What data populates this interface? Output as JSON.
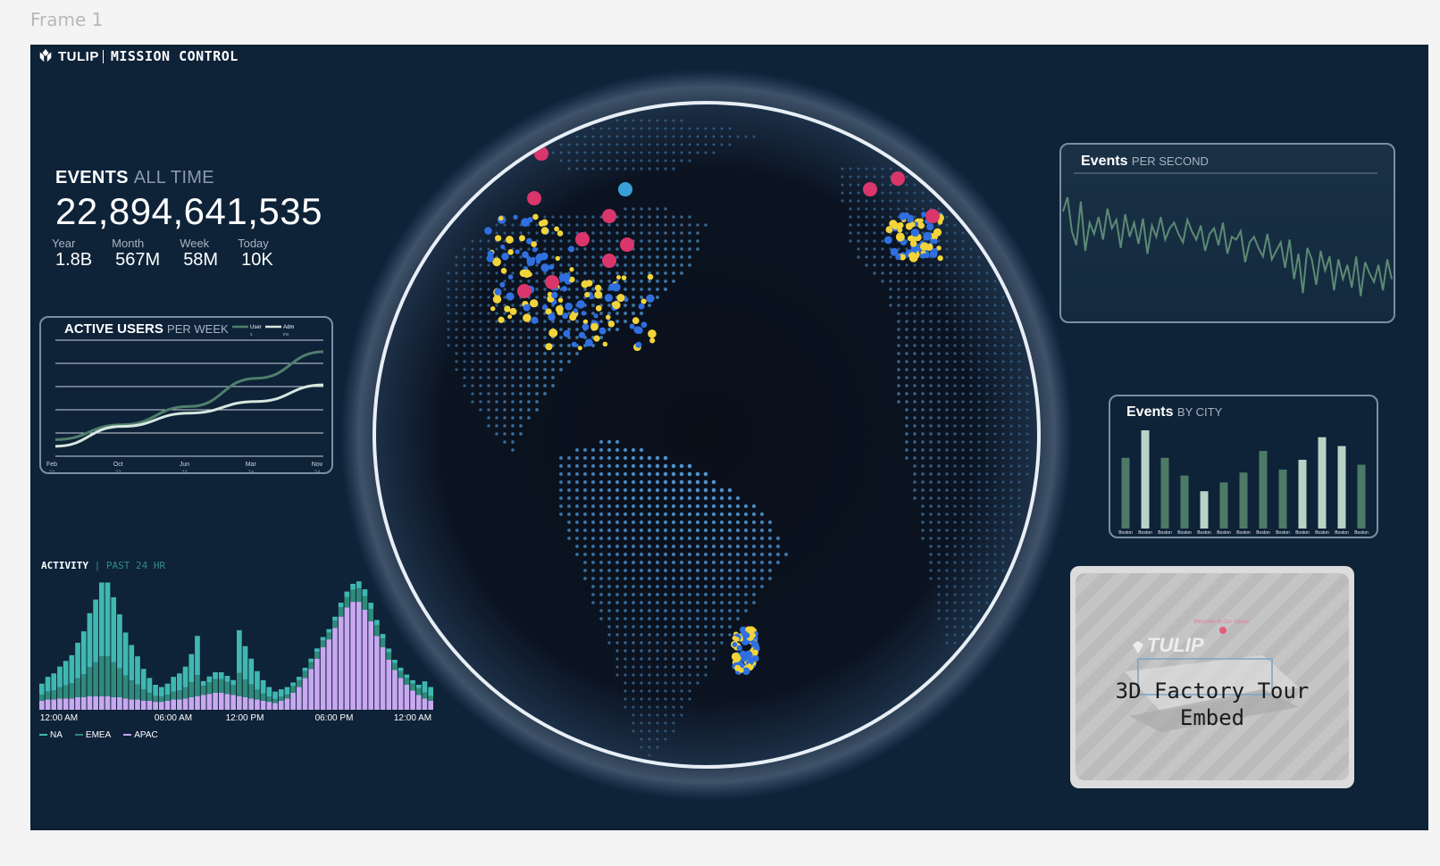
{
  "frame": {
    "label": "Frame 1"
  },
  "header": {
    "logo_text": "TULIP",
    "title": "MISSION CONTROL"
  },
  "events_all_time": {
    "title": "EVENTS",
    "subtitle": "ALL TIME",
    "total": "22,894,641,535",
    "stats": [
      {
        "label": "Year",
        "value": "1.8B"
      },
      {
        "label": "Month",
        "value": "567M"
      },
      {
        "label": "Week",
        "value": "58M"
      },
      {
        "label": "Today",
        "value": "10K"
      }
    ]
  },
  "active_users": {
    "title": "ACTIVE USERS",
    "subtitle": "PER WEEK",
    "legend": [
      {
        "name": "User",
        "sub": "s",
        "color": "#4f7f6c"
      },
      {
        "name": "Adm",
        "sub": "ins",
        "color": "#d6e7df"
      }
    ],
    "x_ticks": [
      {
        "month": "Feb",
        "year": "22"
      },
      {
        "month": "Oct",
        "year": "22"
      },
      {
        "month": "Jun",
        "year": "23"
      },
      {
        "month": "Mar",
        "year": "24"
      },
      {
        "month": "Nov",
        "year": "24"
      }
    ]
  },
  "events_per_second": {
    "title": "Events",
    "subtitle": "PER SECOND",
    "line_color": "#5c8a74"
  },
  "events_by_city": {
    "title": "Events",
    "subtitle": "BY CITY",
    "bar_dark": "#4d7a66",
    "bar_light": "#b9d2c6"
  },
  "activity": {
    "title": "ACTIVITY",
    "subtitle": "PAST 24 HR",
    "x_ticks": [
      "12:00 AM",
      "06:00 AM",
      "12:00 PM",
      "06:00 PM",
      "12:00 AM"
    ],
    "legend": [
      {
        "name": "NA",
        "color": "#3fb8b0"
      },
      {
        "name": "EMEA",
        "color": "#2f8a7a"
      },
      {
        "name": "APAC",
        "color": "#c8a8f0"
      }
    ]
  },
  "embed": {
    "line1": "3D Factory Tour",
    "line2": "Embed",
    "logo_text": "TULIP",
    "tiny_caption": "Welcome to Our Space"
  },
  "chart_data": [
    {
      "type": "line",
      "title": "ACTIVE USERS PER WEEK",
      "categories": [
        "Feb 22",
        "Oct 22",
        "Jun 23",
        "Mar 24",
        "Nov 24"
      ],
      "series": [
        {
          "name": "Users",
          "values": [
            1.0,
            1.9,
            3.0,
            4.7,
            6.3
          ]
        },
        {
          "name": "Admins",
          "values": [
            0.6,
            1.8,
            2.6,
            3.3,
            4.3
          ]
        }
      ],
      "ylim": [
        0,
        7
      ],
      "grid": true
    },
    {
      "type": "line",
      "title": "Events PER SECOND",
      "values": [
        78,
        88,
        64,
        54,
        85,
        50,
        70,
        62,
        74,
        58,
        80,
        66,
        72,
        52,
        76,
        60,
        70,
        55,
        73,
        48,
        68,
        60,
        74,
        58,
        66,
        70,
        62,
        56,
        72,
        64,
        58,
        68,
        50,
        62,
        66,
        54,
        70,
        48,
        60,
        58,
        64,
        42,
        56,
        60,
        52,
        46,
        62,
        44,
        50,
        56,
        38,
        58,
        30,
        48,
        20,
        52,
        44,
        26,
        50,
        36,
        46,
        22,
        44,
        30,
        40,
        24,
        46,
        18,
        42,
        34,
        28,
        40,
        22,
        44,
        30
      ]
    },
    {
      "type": "bar",
      "title": "Events BY CITY",
      "categories": [
        "Boston",
        "Boston",
        "Boston",
        "Boston",
        "Boston",
        "Boston",
        "Boston",
        "Boston",
        "Boston",
        "Boston",
        "Boston",
        "Boston",
        "Boston"
      ],
      "values": [
        72,
        100,
        72,
        54,
        38,
        47,
        57,
        79,
        60,
        70,
        93,
        84,
        65
      ],
      "highlight": [
        false,
        true,
        false,
        false,
        true,
        false,
        false,
        false,
        false,
        true,
        true,
        true,
        false
      ]
    },
    {
      "type": "bar",
      "title": "ACTIVITY PAST 24 HR",
      "stacked": true,
      "categories": [
        "12:00 AM",
        "06:00 AM",
        "12:00 PM",
        "06:00 PM",
        "12:00 AM"
      ],
      "series": [
        {
          "name": "NA",
          "values": [
            15,
            20,
            23,
            28,
            33,
            38,
            48,
            58,
            73,
            85,
            100,
            100,
            88,
            73,
            58,
            48,
            38,
            28,
            20,
            15,
            13,
            15,
            20,
            23,
            28,
            38,
            53,
            68,
            85,
            100,
            100,
            88,
            73,
            58,
            45,
            35,
            25,
            18,
            13,
            10,
            10,
            10,
            12,
            15,
            18,
            23,
            28,
            35,
            45,
            55,
            68,
            78,
            88,
            100,
            100,
            90,
            78,
            65,
            55,
            45,
            38,
            30,
            23,
            18,
            15,
            12
          ]
        },
        {
          "name": "EMEA",
          "values": [
            0,
            0,
            0,
            0,
            0,
            0,
            0,
            0,
            0,
            0,
            0,
            0,
            0,
            0,
            0,
            0,
            0,
            0,
            0,
            0,
            0,
            0,
            0,
            0,
            0,
            0,
            0,
            0,
            0,
            0,
            0,
            0,
            0,
            0,
            0,
            0,
            0,
            0,
            0,
            0,
            0,
            0,
            0,
            0,
            0,
            0,
            0,
            0,
            0,
            0,
            0,
            0,
            0,
            0,
            0,
            0,
            0,
            0,
            0,
            0,
            0,
            0,
            0,
            0,
            0,
            0
          ]
        },
        {
          "name": "APAC",
          "values": [
            8,
            9,
            9,
            10,
            10,
            10,
            11,
            11,
            12,
            12,
            12,
            12,
            11,
            11,
            10,
            9,
            9,
            8,
            8,
            7,
            7,
            8,
            9,
            9,
            10,
            11,
            12,
            13,
            14,
            15,
            15,
            14,
            13,
            12,
            11,
            10,
            9,
            8,
            7,
            6,
            8,
            10,
            15,
            20,
            28,
            36,
            45,
            55,
            62,
            72,
            82,
            90,
            95,
            95,
            88,
            78,
            65,
            55,
            44,
            35,
            28,
            22,
            17,
            13,
            10,
            8
          ]
        }
      ]
    }
  ]
}
